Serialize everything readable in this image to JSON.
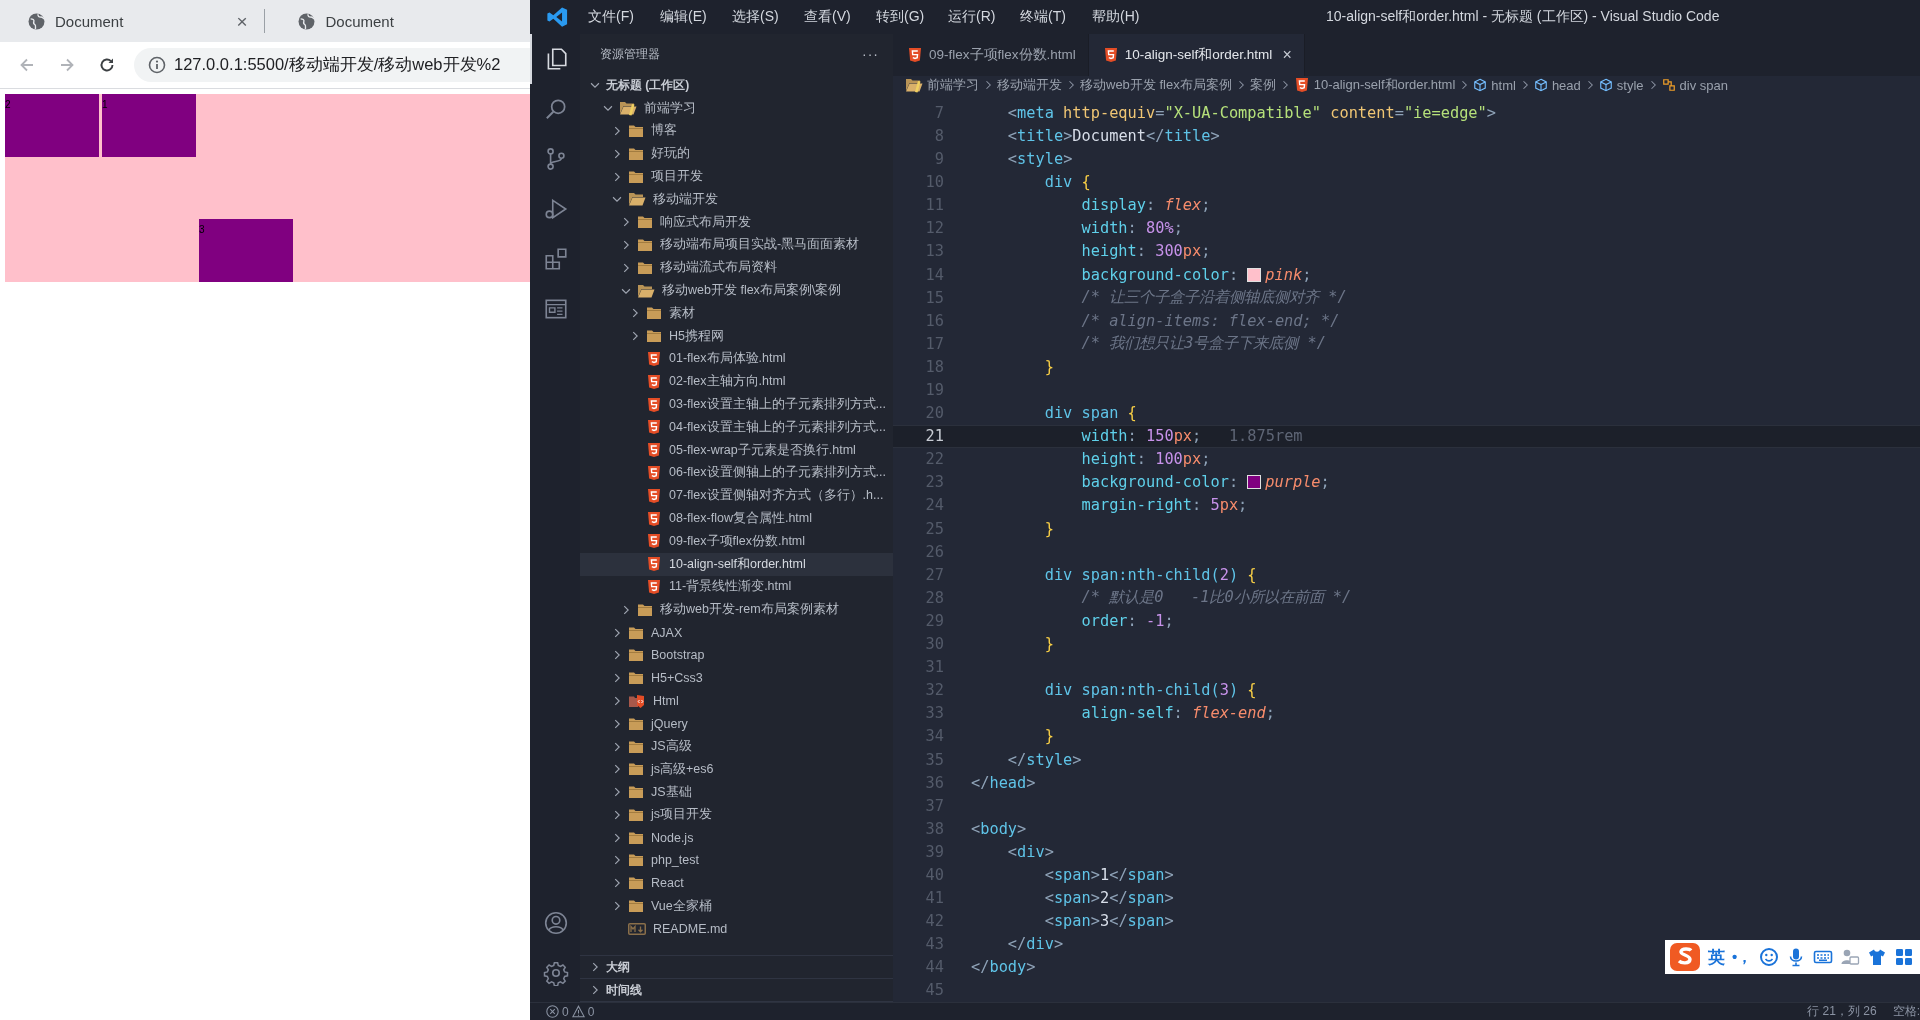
{
  "browser": {
    "tabs": [
      {
        "title": "Document",
        "close": "×"
      },
      {
        "title": "Document"
      }
    ],
    "nav": [
      {
        "kind": "back",
        "disabled": true
      },
      {
        "kind": "forward",
        "disabled": true
      },
      {
        "kind": "reload",
        "disabled": false
      }
    ],
    "url": "127.0.0.1:5500/移动端开发/移动web开发%2",
    "page": {
      "boxes": [
        {
          "label": "2",
          "kind": "normal"
        },
        {
          "label": "1",
          "kind": "normal"
        },
        {
          "label": "3",
          "kind": "flex-end"
        }
      ]
    }
  },
  "vscode": {
    "menu": [
      "文件(F)",
      "编辑(E)",
      "选择(S)",
      "查看(V)",
      "转到(G)",
      "运行(R)",
      "终端(T)",
      "帮助(H)"
    ],
    "title": "10-align-self和order.html - 无标题 (工作区) - Visual Studio Code",
    "activity": [
      {
        "kind": "explorer",
        "selected": true
      },
      {
        "kind": "search",
        "selected": false
      },
      {
        "kind": "source-control",
        "selected": false
      },
      {
        "kind": "run",
        "selected": false
      },
      {
        "kind": "extensions",
        "selected": false
      },
      {
        "kind": "remote",
        "selected": false
      }
    ],
    "activity_bottom": [
      {
        "kind": "account"
      },
      {
        "kind": "settings"
      }
    ],
    "explorer": {
      "title": "资源管理器",
      "more": "···",
      "workspace": {
        "label": "无标题 (工作区)",
        "expanded": true,
        "children": [
          {
            "label": "前端学习",
            "kind": "folder-special",
            "expanded": true,
            "selected": false,
            "children": [
              {
                "label": "博客",
                "kind": "folder",
                "expanded": false,
                "selected": false
              },
              {
                "label": "好玩的",
                "kind": "folder",
                "expanded": false,
                "selected": false
              },
              {
                "label": "项目开发",
                "kind": "folder",
                "expanded": false,
                "selected": false
              },
              {
                "label": "移动端开发",
                "kind": "folder",
                "expanded": true,
                "selected": false,
                "children": [
                  {
                    "label": "响应式布局开发",
                    "kind": "folder",
                    "expanded": false,
                    "selected": false
                  },
                  {
                    "label": "移动端布局项目实战-黑马面面素材",
                    "kind": "folder",
                    "expanded": false,
                    "selected": false
                  },
                  {
                    "label": "移动端流式布局资料",
                    "kind": "folder",
                    "expanded": false,
                    "selected": false
                  },
                  {
                    "label": "移动web开发 flex布局案例\\案例",
                    "kind": "folder",
                    "expanded": true,
                    "selected": false,
                    "children": [
                      {
                        "label": "素材",
                        "kind": "folder",
                        "expanded": false,
                        "selected": false
                      },
                      {
                        "label": "H5携程网",
                        "kind": "folder",
                        "expanded": false,
                        "selected": false
                      },
                      {
                        "label": "01-flex布局体验.html",
                        "kind": "html",
                        "selected": false
                      },
                      {
                        "label": "02-flex主轴方向.html",
                        "kind": "html",
                        "selected": false
                      },
                      {
                        "label": "03-flex设置主轴上的子元素排列方式...",
                        "kind": "html",
                        "selected": false
                      },
                      {
                        "label": "04-flex设置主轴上的子元素排列方式...",
                        "kind": "html",
                        "selected": false
                      },
                      {
                        "label": "05-flex-wrap子元素是否换行.html",
                        "kind": "html",
                        "selected": false
                      },
                      {
                        "label": "06-flex设置侧轴上的子元素排列方式...",
                        "kind": "html",
                        "selected": false
                      },
                      {
                        "label": "07-flex设置侧轴对齐方式（多行）.h...",
                        "kind": "html",
                        "selected": false
                      },
                      {
                        "label": "08-flex-flow复合属性.html",
                        "kind": "html",
                        "selected": false
                      },
                      {
                        "label": "09-flex子项flex份数.html",
                        "kind": "html",
                        "selected": false
                      },
                      {
                        "label": "10-align-self和order.html",
                        "kind": "html",
                        "selected": true
                      },
                      {
                        "label": "11-背景线性渐变.html",
                        "kind": "html",
                        "selected": false
                      }
                    ]
                  },
                  {
                    "label": "移动web开发-rem布局案例素材",
                    "kind": "folder",
                    "expanded": false,
                    "selected": false
                  }
                ]
              },
              {
                "label": "AJAX",
                "kind": "folder",
                "expanded": false,
                "selected": false
              },
              {
                "label": "Bootstrap",
                "kind": "folder",
                "expanded": false,
                "selected": false
              },
              {
                "label": "H5+Css3",
                "kind": "folder",
                "expanded": false,
                "selected": false
              },
              {
                "label": "Html",
                "kind": "folder-html",
                "expanded": false,
                "selected": false
              },
              {
                "label": "jQuery",
                "kind": "folder",
                "expanded": false,
                "selected": false
              },
              {
                "label": "JS高级",
                "kind": "folder",
                "expanded": false,
                "selected": false
              },
              {
                "label": "js高级+es6",
                "kind": "folder",
                "expanded": false,
                "selected": false
              },
              {
                "label": "JS基础",
                "kind": "folder",
                "expanded": false,
                "selected": false
              },
              {
                "label": "js项目开发",
                "kind": "folder",
                "expanded": false,
                "selected": false
              },
              {
                "label": "Node.js",
                "kind": "folder",
                "expanded": false,
                "selected": false
              },
              {
                "label": "php_test",
                "kind": "folder",
                "expanded": false,
                "selected": false
              },
              {
                "label": "React",
                "kind": "folder",
                "expanded": false,
                "selected": false
              },
              {
                "label": "Vue全家桶",
                "kind": "folder",
                "expanded": false,
                "selected": false
              },
              {
                "label": "README.md",
                "kind": "markdown",
                "selected": false
              }
            ]
          }
        ]
      },
      "sections": [
        {
          "label": "大纲",
          "expanded": false
        },
        {
          "label": "时间线",
          "expanded": false
        }
      ]
    },
    "tabs": [
      {
        "label": "09-flex子项flex份数.html",
        "selected": false
      },
      {
        "label": "10-align-self和order.html",
        "selected": true,
        "close": "×"
      }
    ],
    "breadcrumbs": [
      {
        "kind": "folder",
        "label": "前端学习"
      },
      {
        "kind": "plain",
        "label": "移动端开发"
      },
      {
        "kind": "plain",
        "label": "移动web开发 flex布局案例"
      },
      {
        "kind": "plain",
        "label": "案例"
      },
      {
        "kind": "html-file",
        "label": "10-align-self和order.html"
      },
      {
        "kind": "element",
        "label": "html"
      },
      {
        "kind": "element",
        "label": "head"
      },
      {
        "kind": "element",
        "label": "style"
      },
      {
        "kind": "symbol",
        "label": "div span"
      }
    ],
    "code": {
      "lines": [
        {
          "number": "7",
          "current": false,
          "tokens": [
            {
              "kind": "punct",
              "text": "    <"
            },
            {
              "kind": "tag",
              "text": "meta"
            },
            {
              "kind": "attr",
              "text": " http-equiv"
            },
            {
              "kind": "punct",
              "text": "="
            },
            {
              "kind": "string",
              "text": "\"X-UA-Compatible\""
            },
            {
              "kind": "attr",
              "text": " content"
            },
            {
              "kind": "punct",
              "text": "="
            },
            {
              "kind": "string",
              "text": "\"ie=edge\""
            },
            {
              "kind": "punct",
              "text": ">"
            }
          ]
        },
        {
          "number": "8",
          "current": false,
          "tokens": [
            {
              "kind": "punct",
              "text": "    <"
            },
            {
              "kind": "tag",
              "text": "title"
            },
            {
              "kind": "punct",
              "text": ">"
            },
            {
              "kind": "plain",
              "text": "Document"
            },
            {
              "kind": "punct",
              "text": "</"
            },
            {
              "kind": "tag",
              "text": "title"
            },
            {
              "kind": "punct",
              "text": ">"
            }
          ]
        },
        {
          "number": "9",
          "current": false,
          "tokens": [
            {
              "kind": "punct",
              "text": "    <"
            },
            {
              "kind": "tag",
              "text": "style"
            },
            {
              "kind": "punct",
              "text": ">"
            }
          ]
        },
        {
          "number": "10",
          "current": false,
          "tokens": [
            {
              "kind": "selector",
              "text": "        div "
            },
            {
              "kind": "brace",
              "text": "{"
            }
          ]
        },
        {
          "number": "11",
          "current": false,
          "tokens": [
            {
              "kind": "property",
              "text": "            display"
            },
            {
              "kind": "punct",
              "text": ": "
            },
            {
              "kind": "value",
              "text": "flex"
            },
            {
              "kind": "punct",
              "text": ";"
            }
          ]
        },
        {
          "number": "12",
          "current": false,
          "tokens": [
            {
              "kind": "property",
              "text": "            width"
            },
            {
              "kind": "punct",
              "text": ": "
            },
            {
              "kind": "number",
              "text": "80%"
            },
            {
              "kind": "punct",
              "text": ";"
            }
          ]
        },
        {
          "number": "13",
          "current": false,
          "tokens": [
            {
              "kind": "property",
              "text": "            height"
            },
            {
              "kind": "punct",
              "text": ": "
            },
            {
              "kind": "number",
              "text": "300"
            },
            {
              "kind": "unit",
              "text": "px"
            },
            {
              "kind": "punct",
              "text": ";"
            }
          ]
        },
        {
          "number": "14",
          "current": false,
          "tokens": [
            {
              "kind": "property",
              "text": "            background-color"
            },
            {
              "kind": "punct",
              "text": ": "
            },
            {
              "kind": "swatch",
              "color": "#ffc0cb"
            },
            {
              "kind": "value",
              "text": "pink"
            },
            {
              "kind": "punct",
              "text": ";"
            }
          ]
        },
        {
          "number": "15",
          "current": false,
          "tokens": [
            {
              "kind": "comment",
              "text": "            /* 让三个子盒子沿着侧轴底侧对齐 */"
            }
          ]
        },
        {
          "number": "16",
          "current": false,
          "tokens": [
            {
              "kind": "comment",
              "text": "            /* align-items: flex-end; */"
            }
          ]
        },
        {
          "number": "17",
          "current": false,
          "tokens": [
            {
              "kind": "comment",
              "text": "            /* 我们想只让3号盒子下来底侧 */"
            }
          ]
        },
        {
          "number": "18",
          "current": false,
          "tokens": [
            {
              "kind": "brace",
              "text": "        }"
            }
          ]
        },
        {
          "number": "19",
          "current": false
        },
        {
          "number": "20",
          "current": false,
          "tokens": [
            {
              "kind": "selector",
              "text": "        div span "
            },
            {
              "kind": "brace",
              "text": "{"
            }
          ]
        },
        {
          "number": "21",
          "current": true,
          "tokens": [
            {
              "kind": "property",
              "text": "            width"
            },
            {
              "kind": "punct",
              "text": ": "
            },
            {
              "kind": "number",
              "text": "150"
            },
            {
              "kind": "unit",
              "text": "px"
            },
            {
              "kind": "punct",
              "text": ";"
            },
            {
              "kind": "hint",
              "text": "1.875rem"
            }
          ]
        },
        {
          "number": "22",
          "current": false,
          "tokens": [
            {
              "kind": "property",
              "text": "            height"
            },
            {
              "kind": "punct",
              "text": ": "
            },
            {
              "kind": "number",
              "text": "100"
            },
            {
              "kind": "unit",
              "text": "px"
            },
            {
              "kind": "punct",
              "text": ";"
            }
          ]
        },
        {
          "number": "23",
          "current": false,
          "tokens": [
            {
              "kind": "property",
              "text": "            background-color"
            },
            {
              "kind": "punct",
              "text": ": "
            },
            {
              "kind": "swatch",
              "color": "#800080"
            },
            {
              "kind": "value",
              "text": "purple"
            },
            {
              "kind": "punct",
              "text": ";"
            }
          ]
        },
        {
          "number": "24",
          "current": false,
          "tokens": [
            {
              "kind": "property",
              "text": "            margin-right"
            },
            {
              "kind": "punct",
              "text": ": "
            },
            {
              "kind": "number",
              "text": "5"
            },
            {
              "kind": "unit",
              "text": "px"
            },
            {
              "kind": "punct",
              "text": ";"
            }
          ]
        },
        {
          "number": "25",
          "current": false,
          "tokens": [
            {
              "kind": "brace",
              "text": "        }"
            }
          ]
        },
        {
          "number": "26",
          "current": false
        },
        {
          "number": "27",
          "current": false,
          "tokens": [
            {
              "kind": "selector",
              "text": "        div span:nth-child("
            },
            {
              "kind": "number",
              "text": "2"
            },
            {
              "kind": "selector",
              "text": ") "
            },
            {
              "kind": "brace",
              "text": "{"
            }
          ]
        },
        {
          "number": "28",
          "current": false,
          "tokens": [
            {
              "kind": "comment",
              "text": "            /* 默认是0   -1比0小所以在前面 */"
            }
          ]
        },
        {
          "number": "29",
          "current": false,
          "tokens": [
            {
              "kind": "property",
              "text": "            order"
            },
            {
              "kind": "punct",
              "text": ": "
            },
            {
              "kind": "number",
              "text": "-1"
            },
            {
              "kind": "punct",
              "text": ";"
            }
          ]
        },
        {
          "number": "30",
          "current": false,
          "tokens": [
            {
              "kind": "brace",
              "text": "        }"
            }
          ]
        },
        {
          "number": "31",
          "current": false
        },
        {
          "number": "32",
          "current": false,
          "tokens": [
            {
              "kind": "selector",
              "text": "        div span:nth-child("
            },
            {
              "kind": "number",
              "text": "3"
            },
            {
              "kind": "selector",
              "text": ") "
            },
            {
              "kind": "brace",
              "text": "{"
            }
          ]
        },
        {
          "number": "33",
          "current": false,
          "tokens": [
            {
              "kind": "property",
              "text": "            align-self"
            },
            {
              "kind": "punct",
              "text": ": "
            },
            {
              "kind": "value",
              "text": "flex-end"
            },
            {
              "kind": "punct",
              "text": ";"
            }
          ]
        },
        {
          "number": "34",
          "current": false,
          "tokens": [
            {
              "kind": "brace",
              "text": "        }"
            }
          ]
        },
        {
          "number": "35",
          "current": false,
          "tokens": [
            {
              "kind": "punct",
              "text": "    </"
            },
            {
              "kind": "tag",
              "text": "style"
            },
            {
              "kind": "punct",
              "text": ">"
            }
          ]
        },
        {
          "number": "36",
          "current": false,
          "tokens": [
            {
              "kind": "punct",
              "text": "</"
            },
            {
              "kind": "tag",
              "text": "head"
            },
            {
              "kind": "punct",
              "text": ">"
            }
          ]
        },
        {
          "number": "37",
          "current": false
        },
        {
          "number": "38",
          "current": false,
          "tokens": [
            {
              "kind": "punct",
              "text": "<"
            },
            {
              "kind": "tag",
              "text": "body"
            },
            {
              "kind": "punct",
              "text": ">"
            }
          ]
        },
        {
          "number": "39",
          "current": false,
          "tokens": [
            {
              "kind": "punct",
              "text": "    <"
            },
            {
              "kind": "tag",
              "text": "div"
            },
            {
              "kind": "punct",
              "text": ">"
            }
          ]
        },
        {
          "number": "40",
          "current": false,
          "tokens": [
            {
              "kind": "punct",
              "text": "        <"
            },
            {
              "kind": "tag",
              "text": "span"
            },
            {
              "kind": "punct",
              "text": ">"
            },
            {
              "kind": "plain",
              "text": "1"
            },
            {
              "kind": "punct",
              "text": "</"
            },
            {
              "kind": "tag",
              "text": "span"
            },
            {
              "kind": "punct",
              "text": ">"
            }
          ]
        },
        {
          "number": "41",
          "current": false,
          "tokens": [
            {
              "kind": "punct",
              "text": "        <"
            },
            {
              "kind": "tag",
              "text": "span"
            },
            {
              "kind": "punct",
              "text": ">"
            },
            {
              "kind": "plain",
              "text": "2"
            },
            {
              "kind": "punct",
              "text": "</"
            },
            {
              "kind": "tag",
              "text": "span"
            },
            {
              "kind": "punct",
              "text": ">"
            }
          ]
        },
        {
          "number": "42",
          "current": false,
          "tokens": [
            {
              "kind": "punct",
              "text": "        <"
            },
            {
              "kind": "tag",
              "text": "span"
            },
            {
              "kind": "punct",
              "text": ">"
            },
            {
              "kind": "plain",
              "text": "3"
            },
            {
              "kind": "punct",
              "text": "</"
            },
            {
              "kind": "tag",
              "text": "span"
            },
            {
              "kind": "punct",
              "text": ">"
            }
          ]
        },
        {
          "number": "43",
          "current": false,
          "tokens": [
            {
              "kind": "punct",
              "text": "    </"
            },
            {
              "kind": "tag",
              "text": "div"
            },
            {
              "kind": "punct",
              "text": ">"
            }
          ]
        },
        {
          "number": "44",
          "current": false,
          "tokens": [
            {
              "kind": "punct",
              "text": "</"
            },
            {
              "kind": "tag",
              "text": "body"
            },
            {
              "kind": "punct",
              "text": ">"
            }
          ]
        },
        {
          "number": "45",
          "current": false
        }
      ]
    },
    "status": {
      "errors": "0",
      "warnings": "0",
      "position": "行 21，列 26",
      "indent": "空格:"
    },
    "ime": {
      "mode": "英",
      "punct": "•，"
    }
  }
}
